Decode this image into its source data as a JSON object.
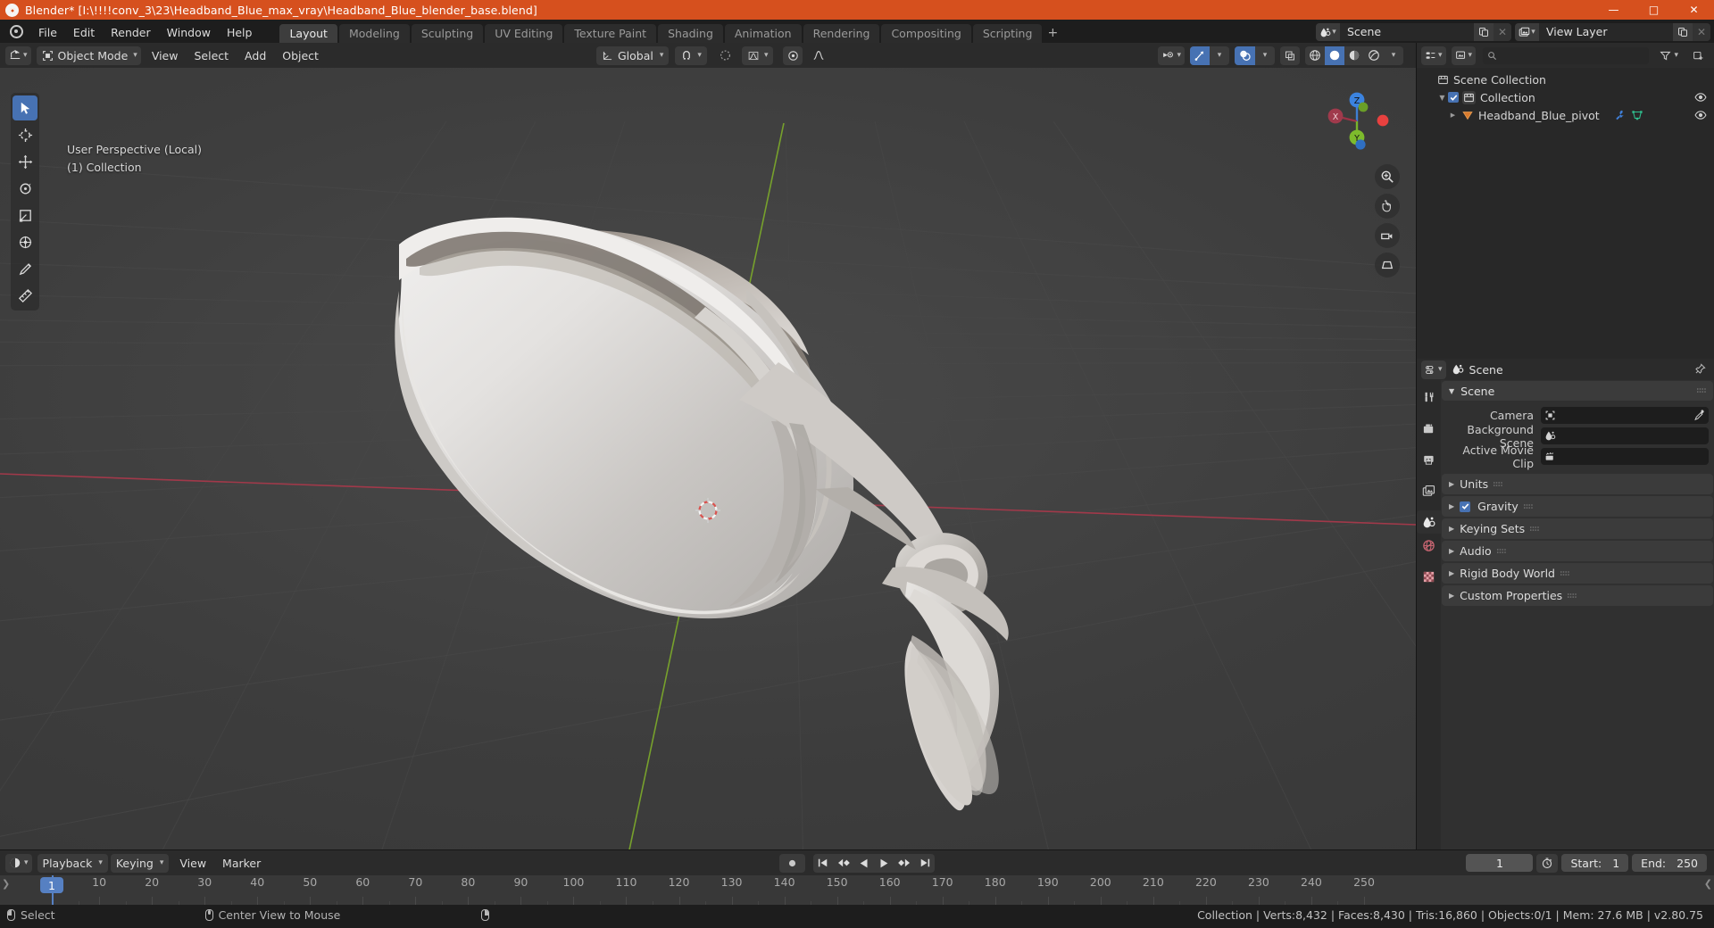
{
  "window": {
    "title": "Blender* [I:\\!!!!conv_3\\23\\Headband_Blue_max_vray\\Headband_Blue_blender_base.blend]",
    "minimize": "—",
    "maximize": "□",
    "close": "✕",
    "accent": "#d6501e"
  },
  "topbar": {
    "menus": [
      "File",
      "Edit",
      "Render",
      "Window",
      "Help"
    ],
    "workspaces": [
      {
        "label": "Layout",
        "active": true
      },
      {
        "label": "Modeling",
        "active": false
      },
      {
        "label": "Sculpting",
        "active": false
      },
      {
        "label": "UV Editing",
        "active": false
      },
      {
        "label": "Texture Paint",
        "active": false
      },
      {
        "label": "Shading",
        "active": false
      },
      {
        "label": "Animation",
        "active": false
      },
      {
        "label": "Rendering",
        "active": false
      },
      {
        "label": "Compositing",
        "active": false
      },
      {
        "label": "Scripting",
        "active": false
      }
    ],
    "add_workspace": "+",
    "scene_field": {
      "value": "Scene",
      "icon": "scene-icon"
    },
    "viewlayer_field": {
      "value": "View Layer",
      "icon": "view-layer-icon"
    }
  },
  "viewport_header": {
    "editor_type_icon": "editor-type-3dview-icon",
    "mode": "Object Mode",
    "menus": [
      "View",
      "Select",
      "Add",
      "Object"
    ],
    "transform_orientation": "Global",
    "snap_icon": "magnet-icon",
    "proportional_icon": "proportional-editing-icon",
    "shading_modes": [
      "wireframe",
      "solid",
      "material-preview",
      "rendered"
    ],
    "active_shading": "solid"
  },
  "viewport": {
    "overlay_line1": "User Perspective (Local)",
    "overlay_line2": "(1) Collection",
    "gizmo_axes": [
      "Z",
      "X",
      "Y"
    ],
    "toolbar_tools": [
      {
        "name": "tweak-select-tool",
        "active": true
      },
      {
        "name": "cursor-tool",
        "active": false
      },
      {
        "name": "move-tool",
        "active": false
      },
      {
        "name": "rotate-tool",
        "active": false
      },
      {
        "name": "scale-tool",
        "active": false
      },
      {
        "name": "transform-tool",
        "active": false
      },
      {
        "name": "annotate-tool",
        "active": false
      },
      {
        "name": "measure-tool",
        "active": false
      }
    ],
    "nav_buttons": [
      "zoom-icon",
      "move-view-icon",
      "camera-view-icon",
      "perspective-toggle-icon"
    ]
  },
  "outliner": {
    "display_mode_icon": "outliner-view-layer-icon",
    "filter_icon": "filter-icon",
    "search_placeholder": "",
    "rows": [
      {
        "label": "Scene Collection",
        "indent": 0,
        "icon": "collection-icon",
        "disclosure": "",
        "checkbox": false,
        "eye": false,
        "extra": []
      },
      {
        "label": "Collection",
        "indent": 1,
        "icon": "collection-icon",
        "disclosure": "▼",
        "checkbox": true,
        "eye": true,
        "extra": []
      },
      {
        "label": "Headband_Blue_pivot",
        "indent": 2,
        "icon": "mesh-object-icon",
        "disclosure": "▶",
        "checkbox": false,
        "eye": true,
        "extra": [
          "modifier-wrench-icon",
          "mesh-data-icon"
        ]
      }
    ]
  },
  "properties": {
    "editor_type_icon": "editor-type-properties-icon",
    "breadcrumb_icon": "scene-icon",
    "breadcrumb": "Scene",
    "pin_icon": "pin-icon",
    "tabs": [
      {
        "name": "tool-tab",
        "icon": "tool-icon",
        "active": false
      },
      {
        "name": "render-tab",
        "icon": "render-camera-icon",
        "active": false
      },
      {
        "name": "output-tab",
        "icon": "printer-icon",
        "active": false
      },
      {
        "name": "view-layer-tab",
        "icon": "images-icon",
        "active": false
      },
      {
        "name": "scene-tab",
        "icon": "scene-droplet-icon",
        "active": true
      },
      {
        "name": "world-tab",
        "icon": "world-globe-icon",
        "active": false
      },
      {
        "name": "texture-tab",
        "icon": "texture-checker-icon",
        "active": false
      }
    ],
    "panel_scene": {
      "title": "Scene",
      "expanded": true,
      "fields": [
        {
          "label": "Camera",
          "value": "",
          "icon": "camera-data-icon",
          "eyedropper": true
        },
        {
          "label": "Background Scene",
          "value": "",
          "icon": "scene-icon",
          "eyedropper": false
        },
        {
          "label": "Active Movie Clip",
          "value": "",
          "icon": "movie-clip-icon",
          "eyedropper": false
        }
      ]
    },
    "sections": [
      {
        "label": "Units",
        "expanded": false,
        "checkbox": null
      },
      {
        "label": "Gravity",
        "expanded": false,
        "checkbox": true
      },
      {
        "label": "Keying Sets",
        "expanded": false,
        "checkbox": null
      },
      {
        "label": "Audio",
        "expanded": false,
        "checkbox": null
      },
      {
        "label": "Rigid Body World",
        "expanded": false,
        "checkbox": null
      },
      {
        "label": "Custom Properties",
        "expanded": false,
        "checkbox": null
      }
    ]
  },
  "timeline": {
    "editor_type_icon": "editor-type-timeline-icon",
    "menus": [
      "Playback",
      "Keying",
      "View",
      "Marker"
    ],
    "dropdowns": [
      "Playback",
      "Keying"
    ],
    "playback_buttons": [
      "record-icon",
      "jump-to-start-icon",
      "prev-keyframe-icon",
      "play-reverse-icon",
      "play-icon",
      "next-keyframe-icon",
      "jump-to-end-icon"
    ],
    "current_frame": "1",
    "use_preview_range_icon": "stopwatch-icon",
    "start_label": "Start:",
    "start_value": "1",
    "end_label": "End:",
    "end_value": "250",
    "ruler_ticks": [
      "1",
      "10",
      "20",
      "30",
      "40",
      "50",
      "60",
      "70",
      "80",
      "90",
      "100",
      "110",
      "120",
      "130",
      "140",
      "150",
      "160",
      "170",
      "180",
      "190",
      "200",
      "210",
      "220",
      "230",
      "240",
      "250"
    ],
    "playhead_frame": "1",
    "accent": "#5680c2"
  },
  "statusbar": {
    "items": [
      {
        "icon": "mouse-left-icon",
        "label": "Select"
      },
      {
        "icon": "mouse-middle-icon",
        "label": "Center View to Mouse"
      },
      {
        "icon": "mouse-right-icon",
        "label": ""
      }
    ],
    "stats": "Collection | Verts:8,432 | Faces:8,430 | Tris:16,860 | Objects:0/1 | Mem: 27.6 MB | v2.80.75"
  }
}
